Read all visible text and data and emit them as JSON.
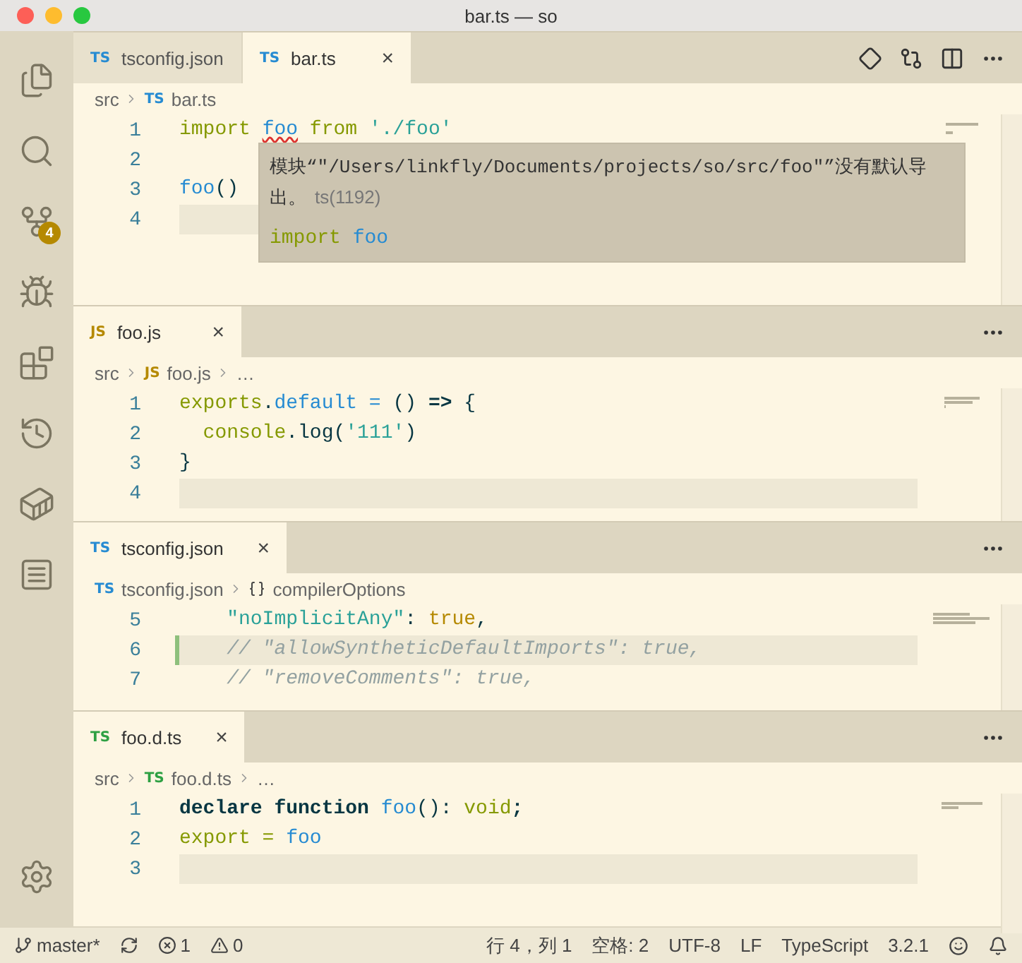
{
  "window": {
    "title": "bar.ts — so"
  },
  "activity_bar": {
    "items": [
      {
        "kind": "files"
      },
      {
        "kind": "search"
      },
      {
        "kind": "source-control",
        "badge": "4"
      },
      {
        "kind": "debug"
      },
      {
        "kind": "extensions"
      },
      {
        "kind": "history"
      },
      {
        "kind": "docker"
      },
      {
        "kind": "outline"
      }
    ],
    "bottom": [
      {
        "kind": "settings"
      }
    ]
  },
  "groups": [
    {
      "tabs": [
        {
          "icon": "TS",
          "color": "#268bd2",
          "label": "tsconfig.json",
          "selected": false
        },
        {
          "icon": "TS",
          "color": "#268bd2",
          "label": "bar.ts",
          "selected": true,
          "close": "×"
        }
      ],
      "actions": [
        {
          "kind": "git"
        },
        {
          "kind": "compare"
        },
        {
          "kind": "split"
        },
        {
          "kind": "more"
        }
      ],
      "breadcrumb": [
        {
          "kind": "folder",
          "text": "src"
        },
        {
          "kind": "file",
          "icon": "TS",
          "color": "#268bd2",
          "text": "bar.ts"
        }
      ],
      "lines": [
        {
          "number": "1",
          "current": false,
          "tokens": [
            {
              "kind": "keyword",
              "text": "import "
            },
            {
              "kind": "name",
              "text": "foo",
              "error": true
            },
            {
              "kind": "keyword",
              "text": " from "
            },
            {
              "kind": "string",
              "text": "'./foo'"
            }
          ]
        },
        {
          "number": "2",
          "current": false
        },
        {
          "number": "3",
          "current": false,
          "tokens": [
            {
              "kind": "name",
              "text": "foo"
            },
            {
              "kind": "text",
              "text": "()"
            }
          ]
        },
        {
          "number": "4",
          "current": true
        }
      ],
      "hover": {
        "message": "模块“\"/Users/linkfly/Documents/projects/so/src/foo\"”没有默认导出。",
        "code": "ts(1192)",
        "snippet": [
          {
            "kind": "keyword",
            "text": "import "
          },
          {
            "kind": "name",
            "text": "foo"
          }
        ]
      }
    },
    {
      "tabs": [
        {
          "icon": "JS",
          "color": "#b58900",
          "label": "foo.js",
          "selected": true,
          "close": "×"
        }
      ],
      "actions": [
        {
          "kind": "more"
        }
      ],
      "breadcrumb": [
        {
          "kind": "folder",
          "text": "src"
        },
        {
          "kind": "file",
          "icon": "JS",
          "color": "#b58900",
          "text": "foo.js"
        },
        {
          "kind": "more",
          "text": "…"
        }
      ],
      "lines": [
        {
          "number": "1",
          "current": false,
          "tokens": [
            {
              "kind": "keyword",
              "text": "exports"
            },
            {
              "kind": "text",
              "text": "."
            },
            {
              "kind": "name",
              "text": "default"
            },
            {
              "kind": "name",
              "text": " = "
            },
            {
              "kind": "text",
              "text": "() "
            },
            {
              "kind": "bold",
              "text": "=>"
            },
            {
              "kind": "text",
              "text": " {"
            }
          ]
        },
        {
          "number": "2",
          "current": false,
          "tokens": [
            {
              "kind": "keyword",
              "text": "  console"
            },
            {
              "kind": "text",
              "text": ".log"
            },
            {
              "kind": "text",
              "text": "("
            },
            {
              "kind": "string",
              "text": "'111'"
            },
            {
              "kind": "text",
              "text": ")"
            }
          ]
        },
        {
          "number": "3",
          "current": false,
          "tokens": [
            {
              "kind": "text",
              "text": "}"
            }
          ]
        },
        {
          "number": "4",
          "current": true
        }
      ]
    },
    {
      "tabs": [
        {
          "icon": "TS",
          "color": "#268bd2",
          "label": "tsconfig.json",
          "selected": true,
          "close": "×"
        }
      ],
      "actions": [
        {
          "kind": "more"
        }
      ],
      "breadcrumb": [
        {
          "kind": "file",
          "icon": "TS",
          "color": "#268bd2",
          "text": "tsconfig.json"
        },
        {
          "kind": "symbol",
          "text": "compilerOptions"
        }
      ],
      "lines": [
        {
          "number": "5",
          "current": false,
          "tokens": [
            {
              "kind": "string",
              "text": "    \"noImplicitAny\""
            },
            {
              "kind": "text",
              "text": ": "
            },
            {
              "kind": "constant",
              "text": "true"
            },
            {
              "kind": "text",
              "text": ","
            }
          ]
        },
        {
          "number": "6",
          "current": true,
          "modified": true,
          "tokens": [
            {
              "kind": "comment",
              "text": "    // \"allowSyntheticDefaultImports\": true,"
            }
          ]
        },
        {
          "number": "7",
          "current": false,
          "tokens": [
            {
              "kind": "comment",
              "text": "    // \"removeComments\": true,"
            }
          ]
        }
      ]
    },
    {
      "tabs": [
        {
          "icon": "TS",
          "color": "#2ea043",
          "label": "foo.d.ts",
          "selected": true,
          "close": "×"
        }
      ],
      "actions": [
        {
          "kind": "more"
        }
      ],
      "breadcrumb": [
        {
          "kind": "folder",
          "text": "src"
        },
        {
          "kind": "file",
          "icon": "TS",
          "color": "#2ea043",
          "text": "foo.d.ts"
        },
        {
          "kind": "more",
          "text": "…"
        }
      ],
      "lines": [
        {
          "number": "1",
          "current": false,
          "tokens": [
            {
              "kind": "bold",
              "text": "declare function "
            },
            {
              "kind": "name",
              "text": "foo"
            },
            {
              "kind": "text",
              "text": "(): "
            },
            {
              "kind": "keyword",
              "text": "void"
            },
            {
              "kind": "bold",
              "text": ";"
            }
          ]
        },
        {
          "number": "2",
          "current": false,
          "tokens": [
            {
              "kind": "keyword",
              "text": "export = "
            },
            {
              "kind": "name",
              "text": "foo"
            }
          ]
        },
        {
          "number": "3",
          "current": true
        }
      ]
    }
  ],
  "status_bar": {
    "left": [
      {
        "kind": "branch",
        "text": "master*"
      },
      {
        "kind": "sync"
      },
      {
        "kind": "errors",
        "text": "1"
      },
      {
        "kind": "warnings",
        "text": "0"
      }
    ],
    "right": [
      {
        "kind": "text",
        "text": "行 4，列 1"
      },
      {
        "kind": "text",
        "text": "空格: 2"
      },
      {
        "kind": "text",
        "text": "UTF-8"
      },
      {
        "kind": "text",
        "text": "LF"
      },
      {
        "kind": "text",
        "text": "TypeScript"
      },
      {
        "kind": "text",
        "text": "3.2.1"
      },
      {
        "kind": "feedback"
      },
      {
        "kind": "bell"
      }
    ]
  }
}
